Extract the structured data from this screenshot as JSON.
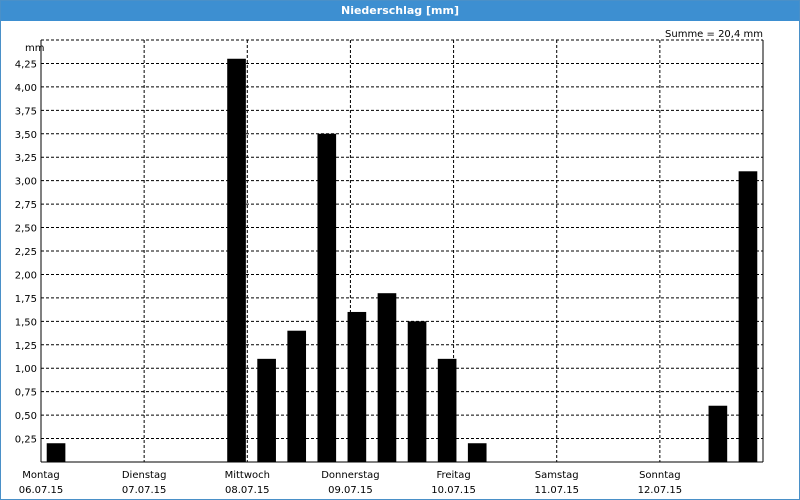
{
  "window": {
    "title": "Niederschlag [mm]"
  },
  "summary": {
    "text": "Summe = 20,4 mm"
  },
  "colors": {
    "titlebar": "#3d8fd1",
    "bar": "#000000",
    "grid": "#000000",
    "background": "#ffffff"
  },
  "chart_data": {
    "type": "bar",
    "title": "Niederschlag [mm]",
    "ylabel": "mm",
    "xlabel": "",
    "ylim": [
      0,
      4.5
    ],
    "y_ticks": [
      "0,25",
      "0,50",
      "0,75",
      "1,00",
      "1,25",
      "1,50",
      "1,75",
      "2,00",
      "2,25",
      "2,50",
      "2,75",
      "3,00",
      "3,25",
      "3,50",
      "3,75",
      "4,00",
      "4,25"
    ],
    "grid": true,
    "days": [
      {
        "name": "Montag",
        "date": "06.07.15"
      },
      {
        "name": "Dienstag",
        "date": "07.07.15"
      },
      {
        "name": "Mittwoch",
        "date": "08.07.15"
      },
      {
        "name": "Donnerstag",
        "date": "09.07.15"
      },
      {
        "name": "Freitag",
        "date": "10.07.15"
      },
      {
        "name": "Samstag",
        "date": "11.07.15"
      },
      {
        "name": "Sonntag",
        "date": "12.07.15"
      }
    ],
    "interval": "6h",
    "values": [
      0.2,
      0,
      0,
      0,
      0,
      0,
      4.3,
      1.1,
      1.4,
      3.5,
      1.6,
      1.8,
      1.5,
      1.1,
      0.2,
      0,
      0,
      0,
      0,
      0,
      0,
      0,
      0.6,
      3.1
    ]
  }
}
